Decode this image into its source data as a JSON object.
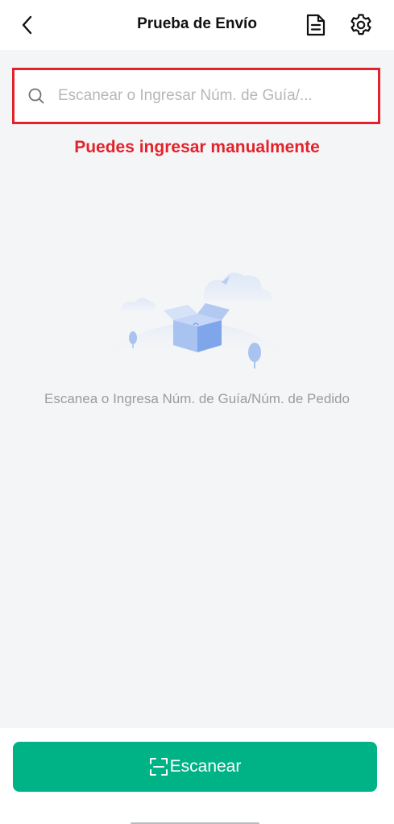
{
  "header": {
    "title": "Prueba de Envío",
    "icons": {
      "back": "chevron-left-icon",
      "document": "document-icon",
      "settings": "gear-icon"
    }
  },
  "search": {
    "placeholder": "Escanear o Ingresar Núm. de Guía/...",
    "value": "",
    "icon": "search-icon"
  },
  "annotation": {
    "text": "Puedes ingresar manualmente",
    "color": "#e3232b"
  },
  "empty_state": {
    "message": "Escanea o Ingresa Núm. de Guía/Núm. de Pedido",
    "illustration": "empty-box-illustration"
  },
  "actions": {
    "scan_label": "Escanear",
    "scan_icon": "scan-icon",
    "accent": "#00b386"
  }
}
